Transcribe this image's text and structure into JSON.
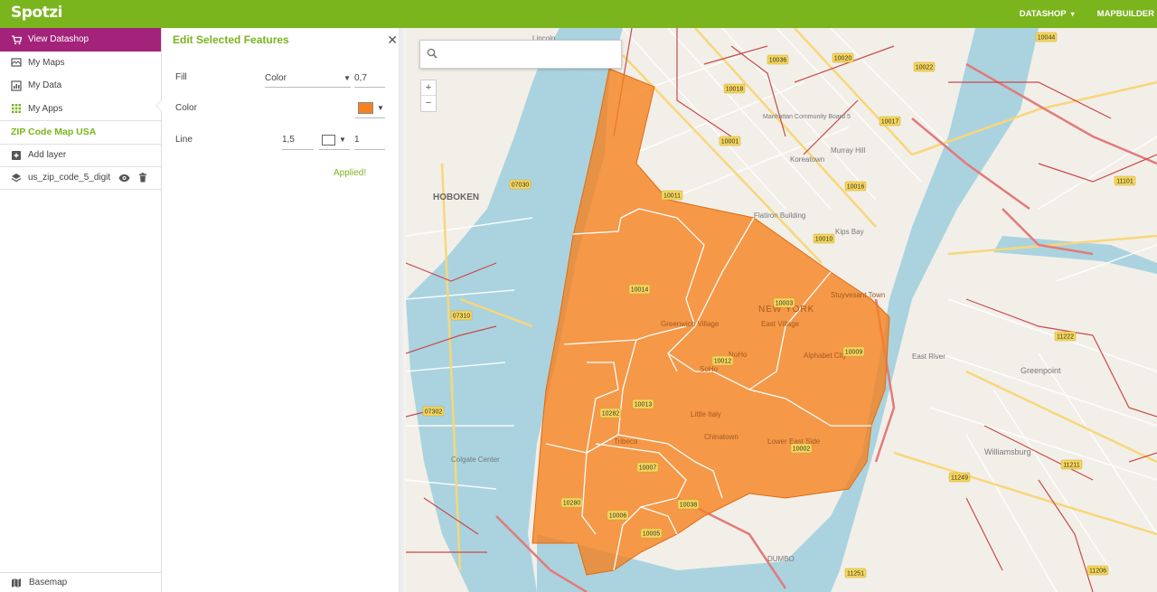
{
  "app": {
    "logo": "Spotzi",
    "nav": [
      {
        "label": "DATASHOP",
        "caret": "▾"
      },
      {
        "label": "MAPBUILDER",
        "caret": ""
      }
    ]
  },
  "sidebar": {
    "items": [
      {
        "label": "View Datashop",
        "icon": "cart-icon",
        "active": true
      },
      {
        "label": "My Maps",
        "icon": "maps-icon"
      },
      {
        "label": "My Data",
        "icon": "data-icon"
      },
      {
        "label": "My Apps",
        "icon": "apps-grid-icon"
      }
    ],
    "map_title": "ZIP Code Map USA",
    "add_layer": "Add layer",
    "layers": [
      {
        "name": "us_zip_code_5_digit"
      }
    ],
    "basemap": "Basemap"
  },
  "edit_panel": {
    "title": "Edit Selected Features",
    "fill": {
      "label": "Fill",
      "type": "Color",
      "opacity": "0,7"
    },
    "color": {
      "label": "Color",
      "swatch": "#f5821f"
    },
    "line": {
      "label": "Line",
      "width": "1,5",
      "swatch": "#ffffff",
      "opacity": "1"
    },
    "status": "Applied!"
  },
  "map": {
    "search_placeholder": "",
    "zoom_in": "+",
    "zoom_out": "−",
    "highlight_color": "#f5821f",
    "place_labels": [
      "HOBOKEN",
      "NEW YORK",
      "Greenpoint",
      "Williamsburg",
      "DUMBO",
      "East River",
      "Colgate Center",
      "Flatiron Building",
      "Koreatown",
      "Manhattan Community Board 5",
      "Murray Hill",
      "Kips Bay",
      "Stuyvesant Town",
      "East Village",
      "Alphabet City",
      "Little Italy",
      "Chinatown",
      "Lower East Side",
      "Greenwich Village",
      "SoHo",
      "NoHo",
      "Tribeca",
      "Lincoln"
    ],
    "zip_labels": [
      {
        "zip": "10044"
      },
      {
        "zip": "10036"
      },
      {
        "zip": "10020"
      },
      {
        "zip": "10022"
      },
      {
        "zip": "10018"
      },
      {
        "zip": "10017"
      },
      {
        "zip": "10001"
      },
      {
        "zip": "10016"
      },
      {
        "zip": "10011"
      },
      {
        "zip": "10010"
      },
      {
        "zip": "07030"
      },
      {
        "zip": "11101"
      },
      {
        "zip": "10014"
      },
      {
        "zip": "10003"
      },
      {
        "zip": "07310"
      },
      {
        "zip": "11222"
      },
      {
        "zip": "10012"
      },
      {
        "zip": "10009"
      },
      {
        "zip": "10013"
      },
      {
        "zip": "07302"
      },
      {
        "zip": "10282"
      },
      {
        "zip": "10002"
      },
      {
        "zip": "10007"
      },
      {
        "zip": "11249"
      },
      {
        "zip": "11211"
      },
      {
        "zip": "10280"
      },
      {
        "zip": "10038"
      },
      {
        "zip": "10006"
      },
      {
        "zip": "10005"
      },
      {
        "zip": "11251"
      },
      {
        "zip": "11206"
      }
    ]
  }
}
